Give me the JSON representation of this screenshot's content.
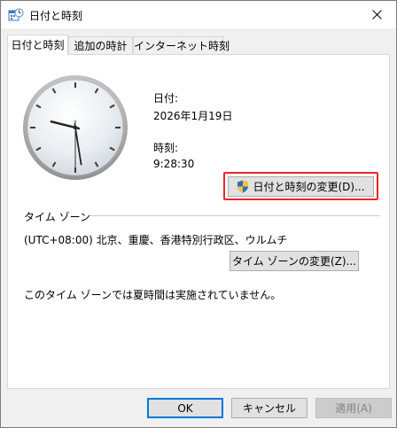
{
  "window": {
    "title": "日付と時刻",
    "icon": "datetime-app-icon"
  },
  "tabs": [
    {
      "label": "日付と時刻",
      "active": true
    },
    {
      "label": "追加の時計",
      "active": false
    },
    {
      "label": "インターネット時刻",
      "active": false
    }
  ],
  "date": {
    "label": "日付:",
    "value": "2026年1月19日"
  },
  "time": {
    "label": "時刻:",
    "value": "9:28:30"
  },
  "clock": {
    "hour": 9,
    "minute": 28,
    "second": 30
  },
  "change_datetime_button": "日付と時刻の変更(D)...",
  "timezone": {
    "group_label": "タイム ゾーン",
    "value": "(UTC+08:00) 北京、重慶、香港特別行政区、ウルムチ",
    "change_button": "タイム ゾーンの変更(Z)...",
    "dst_note": "このタイム ゾーンでは夏時間は実施されていません。"
  },
  "footer": {
    "ok": "OK",
    "cancel": "キャンセル",
    "apply": "適用(A)"
  },
  "colors": {
    "highlight": "#e8262b",
    "default_button_border": "#0078d7"
  }
}
